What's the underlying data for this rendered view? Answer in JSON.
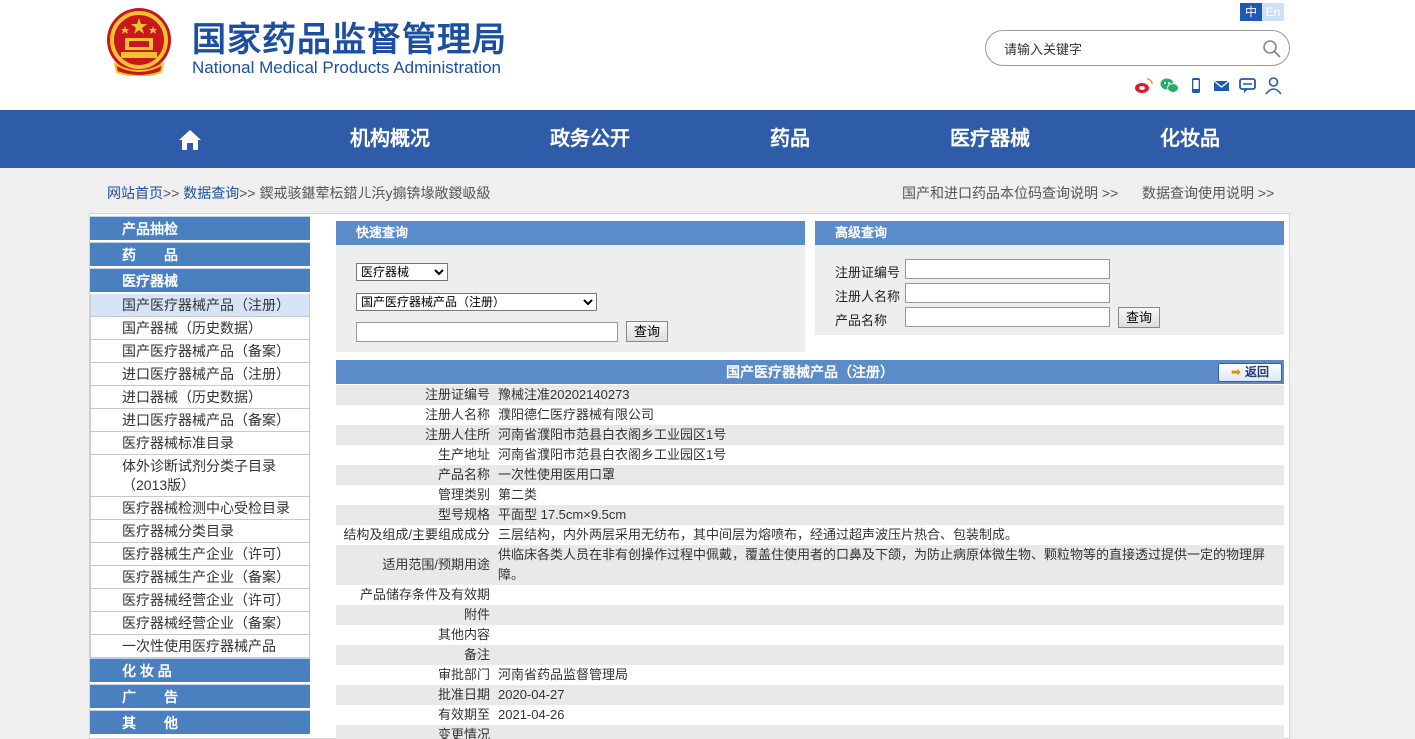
{
  "header": {
    "title_cn": "国家药品监督管理局",
    "title_en": "National Medical Products Administration",
    "lang_zh": "中",
    "lang_en": "En",
    "search_placeholder": "请输入关键字",
    "social_icons": [
      "weibo-icon",
      "wechat-icon",
      "mobile-icon",
      "mail-icon",
      "message-icon",
      "user-icon"
    ]
  },
  "nav": {
    "items": [
      "机构概况",
      "政务公开",
      "药品",
      "医疗器械",
      "化妆品"
    ],
    "home_icon": "home-icon"
  },
  "breadcrumb": {
    "home": "网站首页",
    "data": "数据查询",
    "sep": ">>",
    "current": "鍥戒骇鍖荤枟鍣ㄦ浜у搧锛堟敞鍐岋級",
    "right1": "国产和进口药品本位码查询说明 >>",
    "right2": "数据查询使用说明 >>"
  },
  "sidebar": {
    "cat1": "产品抽检",
    "cat2": "药　　品",
    "cat3": "医疗器械",
    "items": [
      "国产医疗器械产品（注册）",
      "国产器械（历史数据）",
      "国产医疗器械产品（备案）",
      "进口医疗器械产品（注册）",
      "进口器械（历史数据）",
      "进口医疗器械产品（备案）",
      "医疗器械标准目录",
      "体外诊断试剂分类子目录（2013版）",
      "医疗器械检测中心受检目录",
      "医疗器械分类目录",
      "医疗器械生产企业（许可）",
      "医疗器械生产企业（备案）",
      "医疗器械经营企业（许可）",
      "医疗器械经营企业（备案）",
      "一次性使用医疗器械产品"
    ],
    "cat4": "化 妆 品",
    "cat5": "广　　告",
    "cat6": "其　　他"
  },
  "quick": {
    "title": "快速查询",
    "select1": "医疗器械",
    "select2": "国产医疗器械产品（注册）",
    "query_value": "",
    "button": "查询"
  },
  "advanced": {
    "title": "高级查询",
    "label1": "注册证编号",
    "label2": "注册人名称",
    "label3": "产品名称",
    "button": "查询"
  },
  "detail": {
    "title": "国产医疗器械产品（注册）",
    "back": "返回",
    "rows": [
      {
        "k": "注册证编号",
        "v": "豫械注准20202140273"
      },
      {
        "k": "注册人名称",
        "v": "濮阳德仁医疗器械有限公司"
      },
      {
        "k": "注册人住所",
        "v": "河南省濮阳市范县白衣阁乡工业园区1号"
      },
      {
        "k": "生产地址",
        "v": "河南省濮阳市范县白衣阁乡工业园区1号"
      },
      {
        "k": "产品名称",
        "v": "一次性使用医用口罩"
      },
      {
        "k": "管理类别",
        "v": "第二类"
      },
      {
        "k": "型号规格",
        "v": "平面型 17.5cm×9.5cm"
      },
      {
        "k": "结构及组成/主要组成成分",
        "v": "三层结构，内外两层采用无纺布，其中间层为熔喷布，经通过超声波压片热合、包装制成。"
      },
      {
        "k": "适用范围/预期用途",
        "v": "供临床各类人员在非有创操作过程中佩戴，覆盖住使用者的口鼻及下颌，为防止病原体微生物、颗粒物等的直接透过提供一定的物理屏障。"
      },
      {
        "k": "产品储存条件及有效期",
        "v": ""
      },
      {
        "k": "附件",
        "v": ""
      },
      {
        "k": "其他内容",
        "v": ""
      },
      {
        "k": "备注",
        "v": ""
      },
      {
        "k": "审批部门",
        "v": "河南省药品监督管理局"
      },
      {
        "k": "批准日期",
        "v": "2020-04-27"
      },
      {
        "k": "有效期至",
        "v": "2021-04-26"
      },
      {
        "k": "变更情况",
        "v": ""
      }
    ]
  }
}
